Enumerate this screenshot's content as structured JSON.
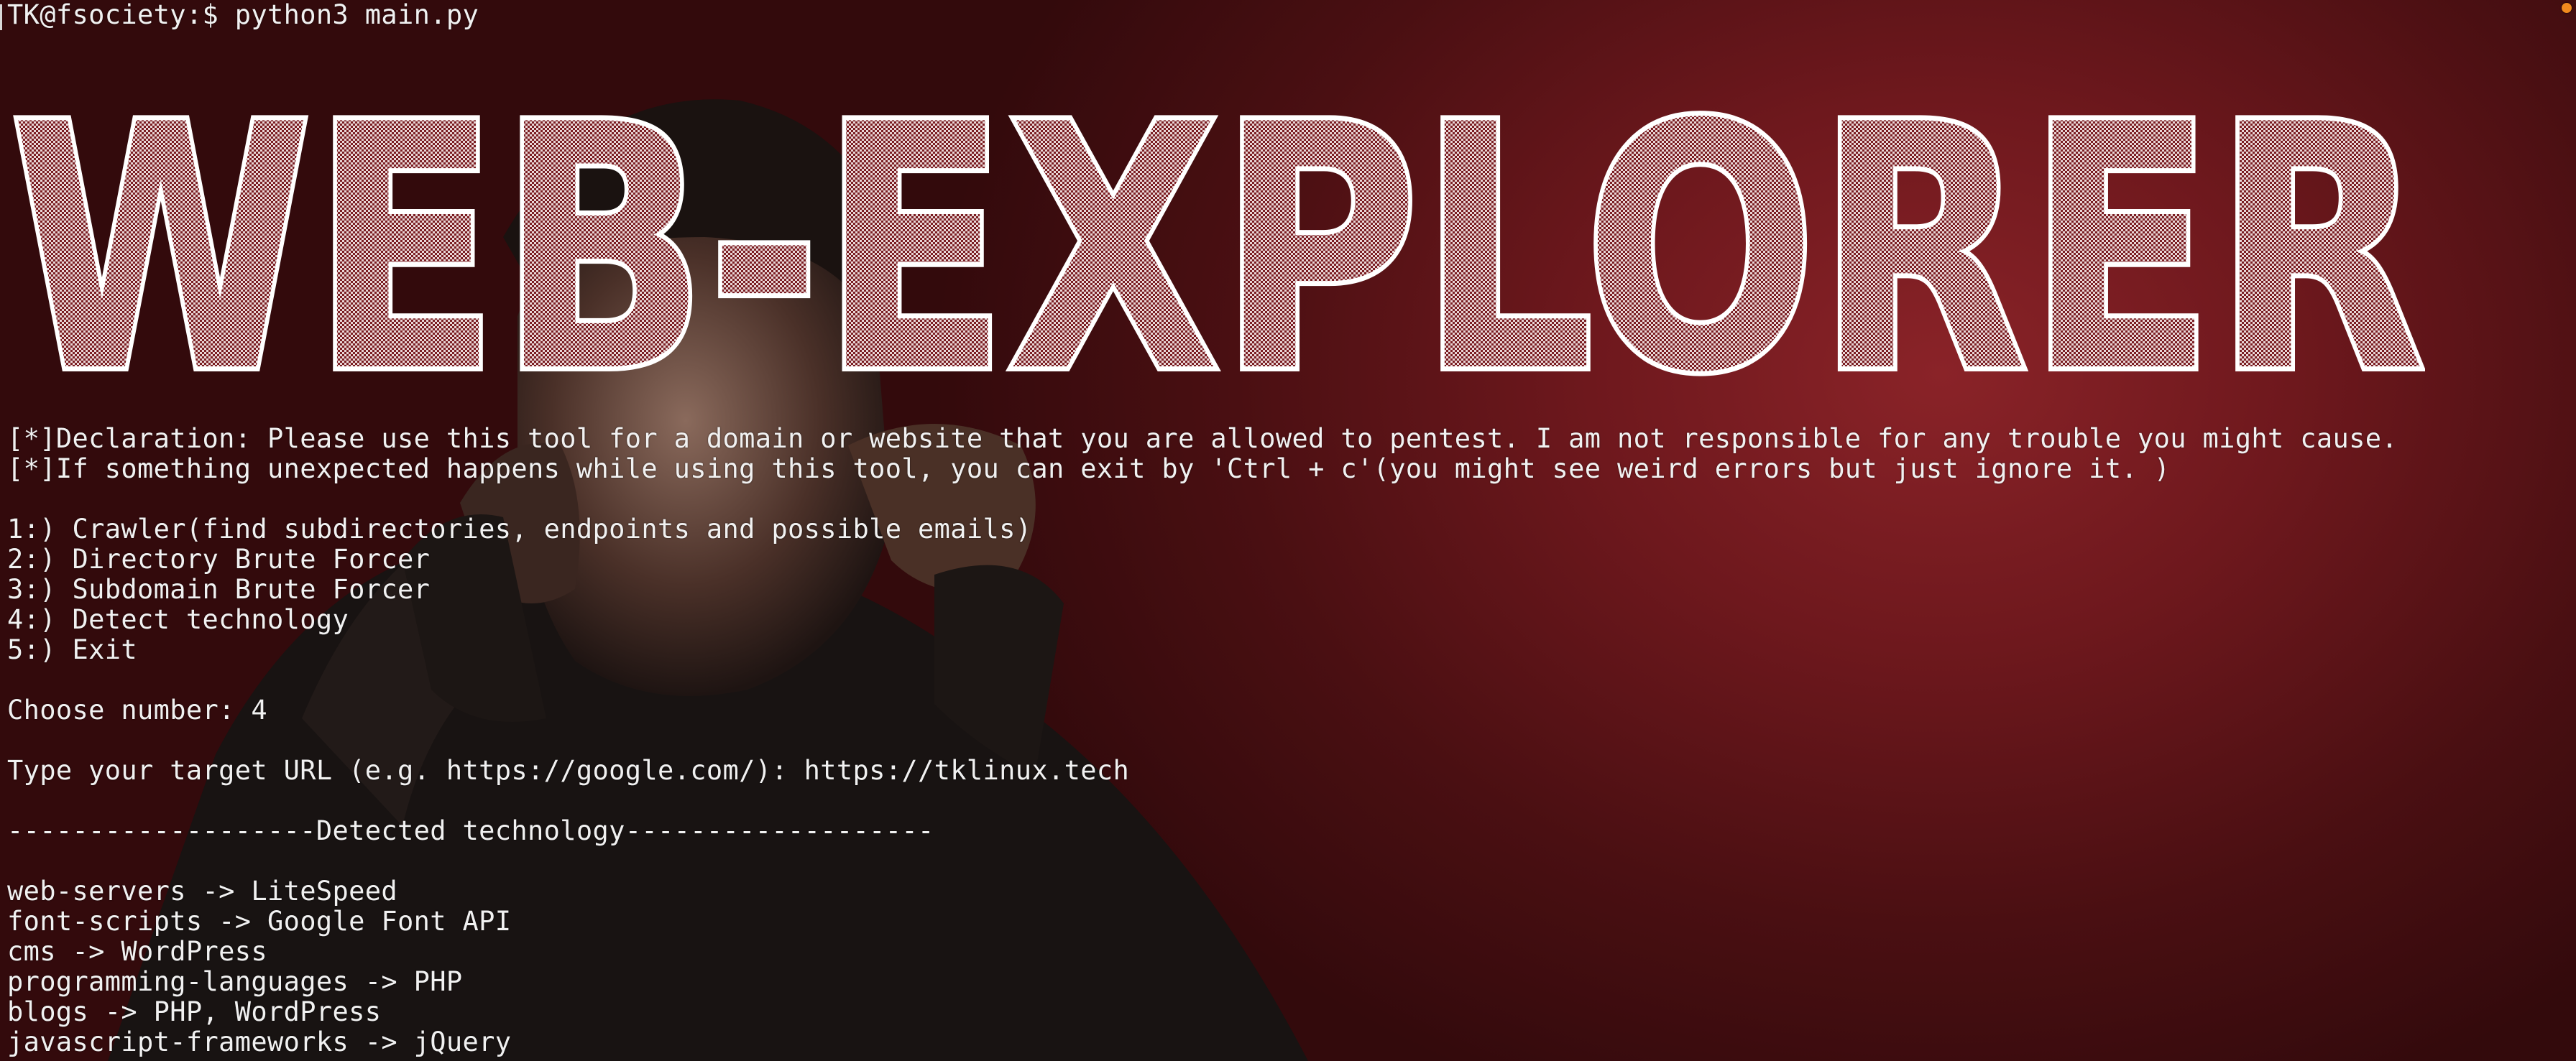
{
  "terminal": {
    "prompt": "TK@fsociety:$ python3 main.py",
    "banner_text": "WEB-EXPLORER",
    "declaration_1": "[*]Declaration: Please use this tool for a domain or website that you are allowed to pentest. I am not responsible for any trouble you might cause.",
    "declaration_2": "[*]If something unexpected happens while using this tool, you can exit by 'Ctrl + c'(you might see weird errors but just ignore it. )",
    "menu": [
      "1:) Crawler(find subdirectories, endpoints and possible emails)",
      "2:) Directory Brute Forcer",
      "3:) Subdomain Brute Forcer",
      "4:) Detect technology",
      "5:) Exit"
    ],
    "choose_prompt": "Choose number: 4",
    "url_prompt": "Type your target URL (e.g. https://google.com/): https://tklinux.tech",
    "section_header": "-------------------Detected technology-------------------",
    "results": [
      "web-servers -> LiteSpeed",
      "font-scripts -> Google Font API",
      "cms -> WordPress",
      "programming-languages -> PHP",
      "blogs -> PHP, WordPress",
      "javascript-frameworks -> jQuery"
    ]
  },
  "colors": {
    "background": "#6e181d",
    "text": "#f1f1f1",
    "window_dot": "#f28a1e"
  }
}
